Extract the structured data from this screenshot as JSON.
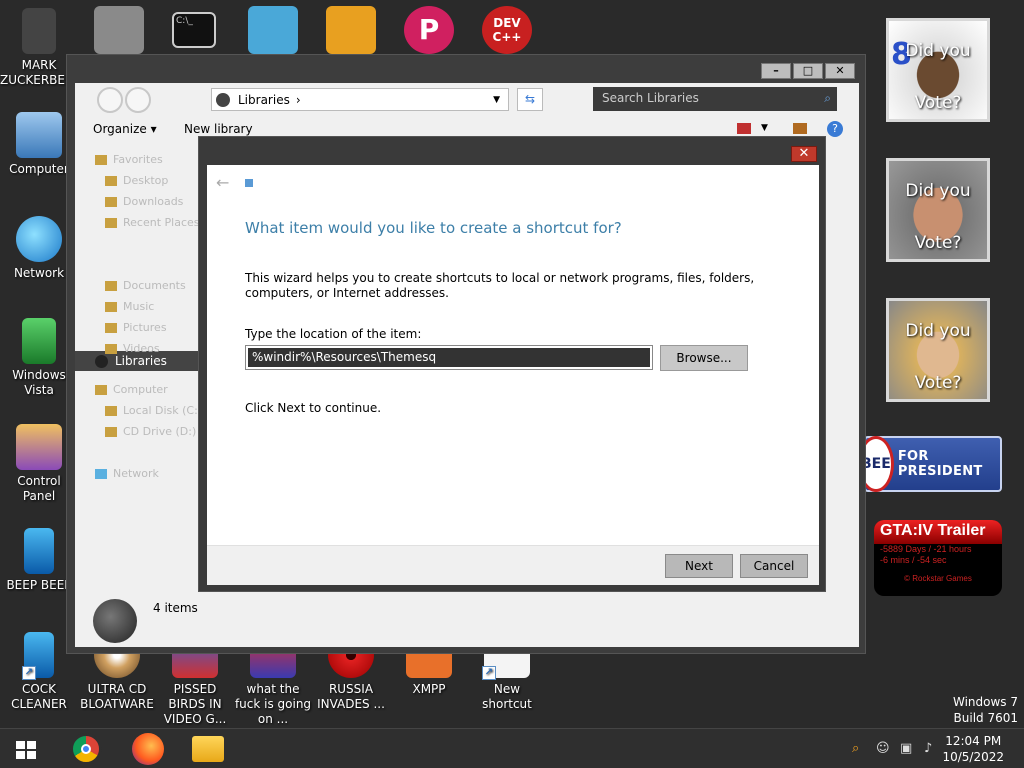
{
  "desktop": {
    "left_icons": [
      {
        "label": "MARK ZUCKERBERG",
        "icon": "zuckerberg-icon"
      },
      {
        "label": "Computer",
        "icon": "computer-icon"
      },
      {
        "label": "Network",
        "icon": "network-icon"
      },
      {
        "label": "Windows Vista",
        "icon": "recycle-bin-icon"
      },
      {
        "label": "Control Panel",
        "icon": "control-panel-icon"
      },
      {
        "label": "BEEP BEEP",
        "icon": "beep-icon"
      },
      {
        "label": "COCK CLEANER",
        "icon": "cleaner-icon"
      }
    ],
    "bottom_icons": [
      {
        "label": "ULTRA CD BLOATWARE",
        "icon": "cd-icon"
      },
      {
        "label": "PISSED BIRDS IN VIDEO G...",
        "icon": "birds-icon"
      },
      {
        "label": "what the fuck is going on ...",
        "icon": "pike-icon"
      },
      {
        "label": "RUSSIA INVADES ...",
        "icon": "radiation-icon"
      },
      {
        "label": "XMPP",
        "icon": "xampp-icon"
      },
      {
        "label": "New shortcut",
        "icon": "shortcut-icon"
      }
    ],
    "top_icons": [
      {
        "icon": "documents-icon"
      },
      {
        "icon": "cmd-icon",
        "text": "C:\\_"
      },
      {
        "icon": "nyan-icon"
      },
      {
        "icon": "pig-icon"
      },
      {
        "icon": "publisher-icon",
        "text": "P"
      },
      {
        "icon": "devcpp-icon",
        "text": "DEV C++"
      }
    ],
    "windows_version": [
      "Windows 7",
      "Build 7601"
    ]
  },
  "gadgets": {
    "vote": [
      {
        "line1": "Did you",
        "line2": "Vote?",
        "badge": "8"
      },
      {
        "line1": "Did you",
        "line2": "Vote?"
      },
      {
        "line1": "Did you",
        "line2": "Vote?"
      }
    ],
    "president": {
      "badge": "BEE",
      "text": "FOR PRESIDENT"
    },
    "gta": {
      "title": "GTA:IV Trailer",
      "line1": "-5889 Days / -21 hours",
      "line2": "-6 mins / -54 sec",
      "footer": "© Rockstar Games"
    }
  },
  "explorer": {
    "controls": {
      "minimize": "–",
      "maximize": "□",
      "close": "✕"
    },
    "address": {
      "crumb": "Libraries",
      "sep": "›"
    },
    "search": {
      "placeholder": "Search Libraries"
    },
    "commands": {
      "organize": "Organize ▾",
      "new_library": "New library"
    },
    "sidebar": {
      "favorites": "Favorites",
      "fav_items": [
        "Desktop",
        "Downloads",
        "Recent Places"
      ],
      "libraries": "Libraries",
      "lib_items": [
        "Documents",
        "Music",
        "Pictures",
        "Videos"
      ],
      "computer": "Computer",
      "comp_items": [
        "Local Disk (C:)",
        "CD Drive (D:)"
      ],
      "network": "Network"
    },
    "status": "4 items"
  },
  "wizard": {
    "close": "✕",
    "heading": "What item would you like to create a shortcut for?",
    "description": "This wizard helps you to create shortcuts to local or network programs, files, folders, computers, or Internet addresses.",
    "field_label": "Type the location of the item:",
    "field_value": "%windir%\\Resources\\Themesq",
    "browse": "Browse...",
    "continue_text": "Click Next to continue.",
    "next": "Next",
    "cancel": "Cancel"
  },
  "taskbar": {
    "apps": [
      "chrome-icon",
      "firefox-icon",
      "explorer-icon"
    ],
    "clock": {
      "time": "12:04 PM",
      "date": "10/5/2022"
    }
  },
  "colors": {
    "accent_heading": "#3d7fa8",
    "close_red": "#c0392b"
  }
}
